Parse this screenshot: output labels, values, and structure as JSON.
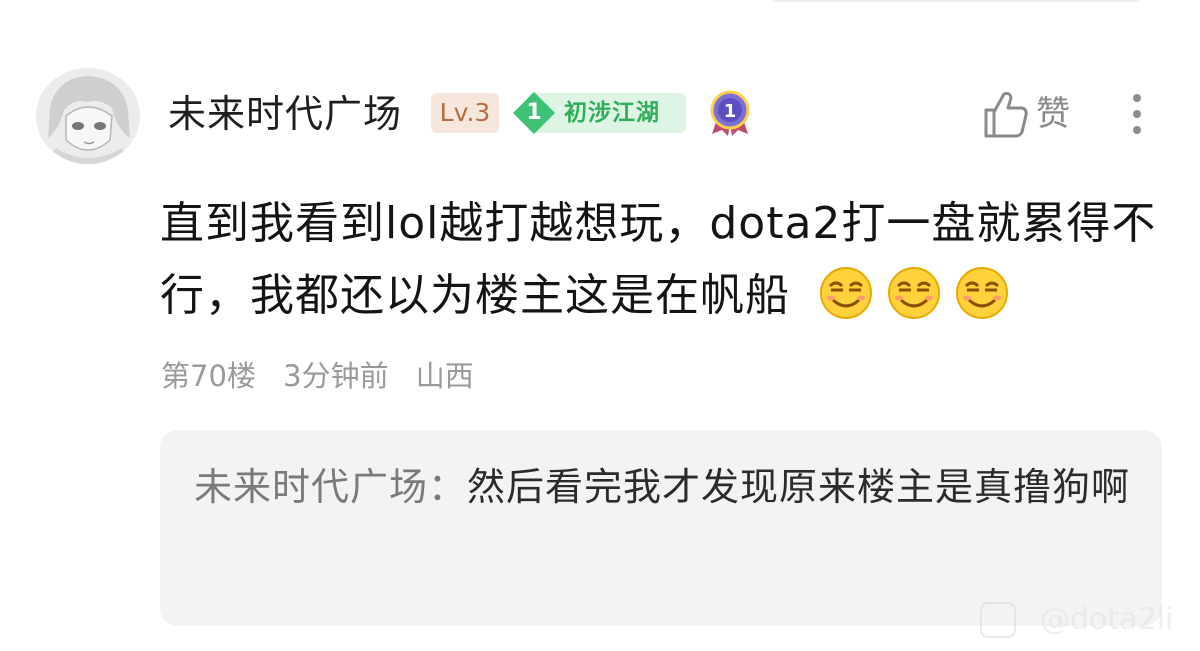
{
  "comment": {
    "username": "未来时代广场",
    "level_badge": "Lv.3",
    "rank_number": "1",
    "rank_title": "初涉江湖",
    "like_label": "赞",
    "body": "直到我看到lol越打越想玩，dota2打一盘就累得不行，我都还以为楼主这是在帆船",
    "emoji_icons": [
      "smirk-emoji-icon",
      "smirk-emoji-icon",
      "smirk-emoji-icon"
    ],
    "meta": {
      "floor": "第70楼",
      "time": "3分钟前",
      "location": "山西"
    }
  },
  "reply": {
    "author": "未来时代广场",
    "separator": "：",
    "text": "然后看完我才发现原来楼主是真撸狗啊"
  },
  "watermark": {
    "handle": "@dota2li"
  },
  "colors": {
    "level_badge_bg": "#f6e6db",
    "level_badge_text": "#b36e44",
    "rank_badge_bg": "#def5e5",
    "rank_badge_accent": "#2fae5a",
    "reply_bg": "#f3f3f5"
  }
}
